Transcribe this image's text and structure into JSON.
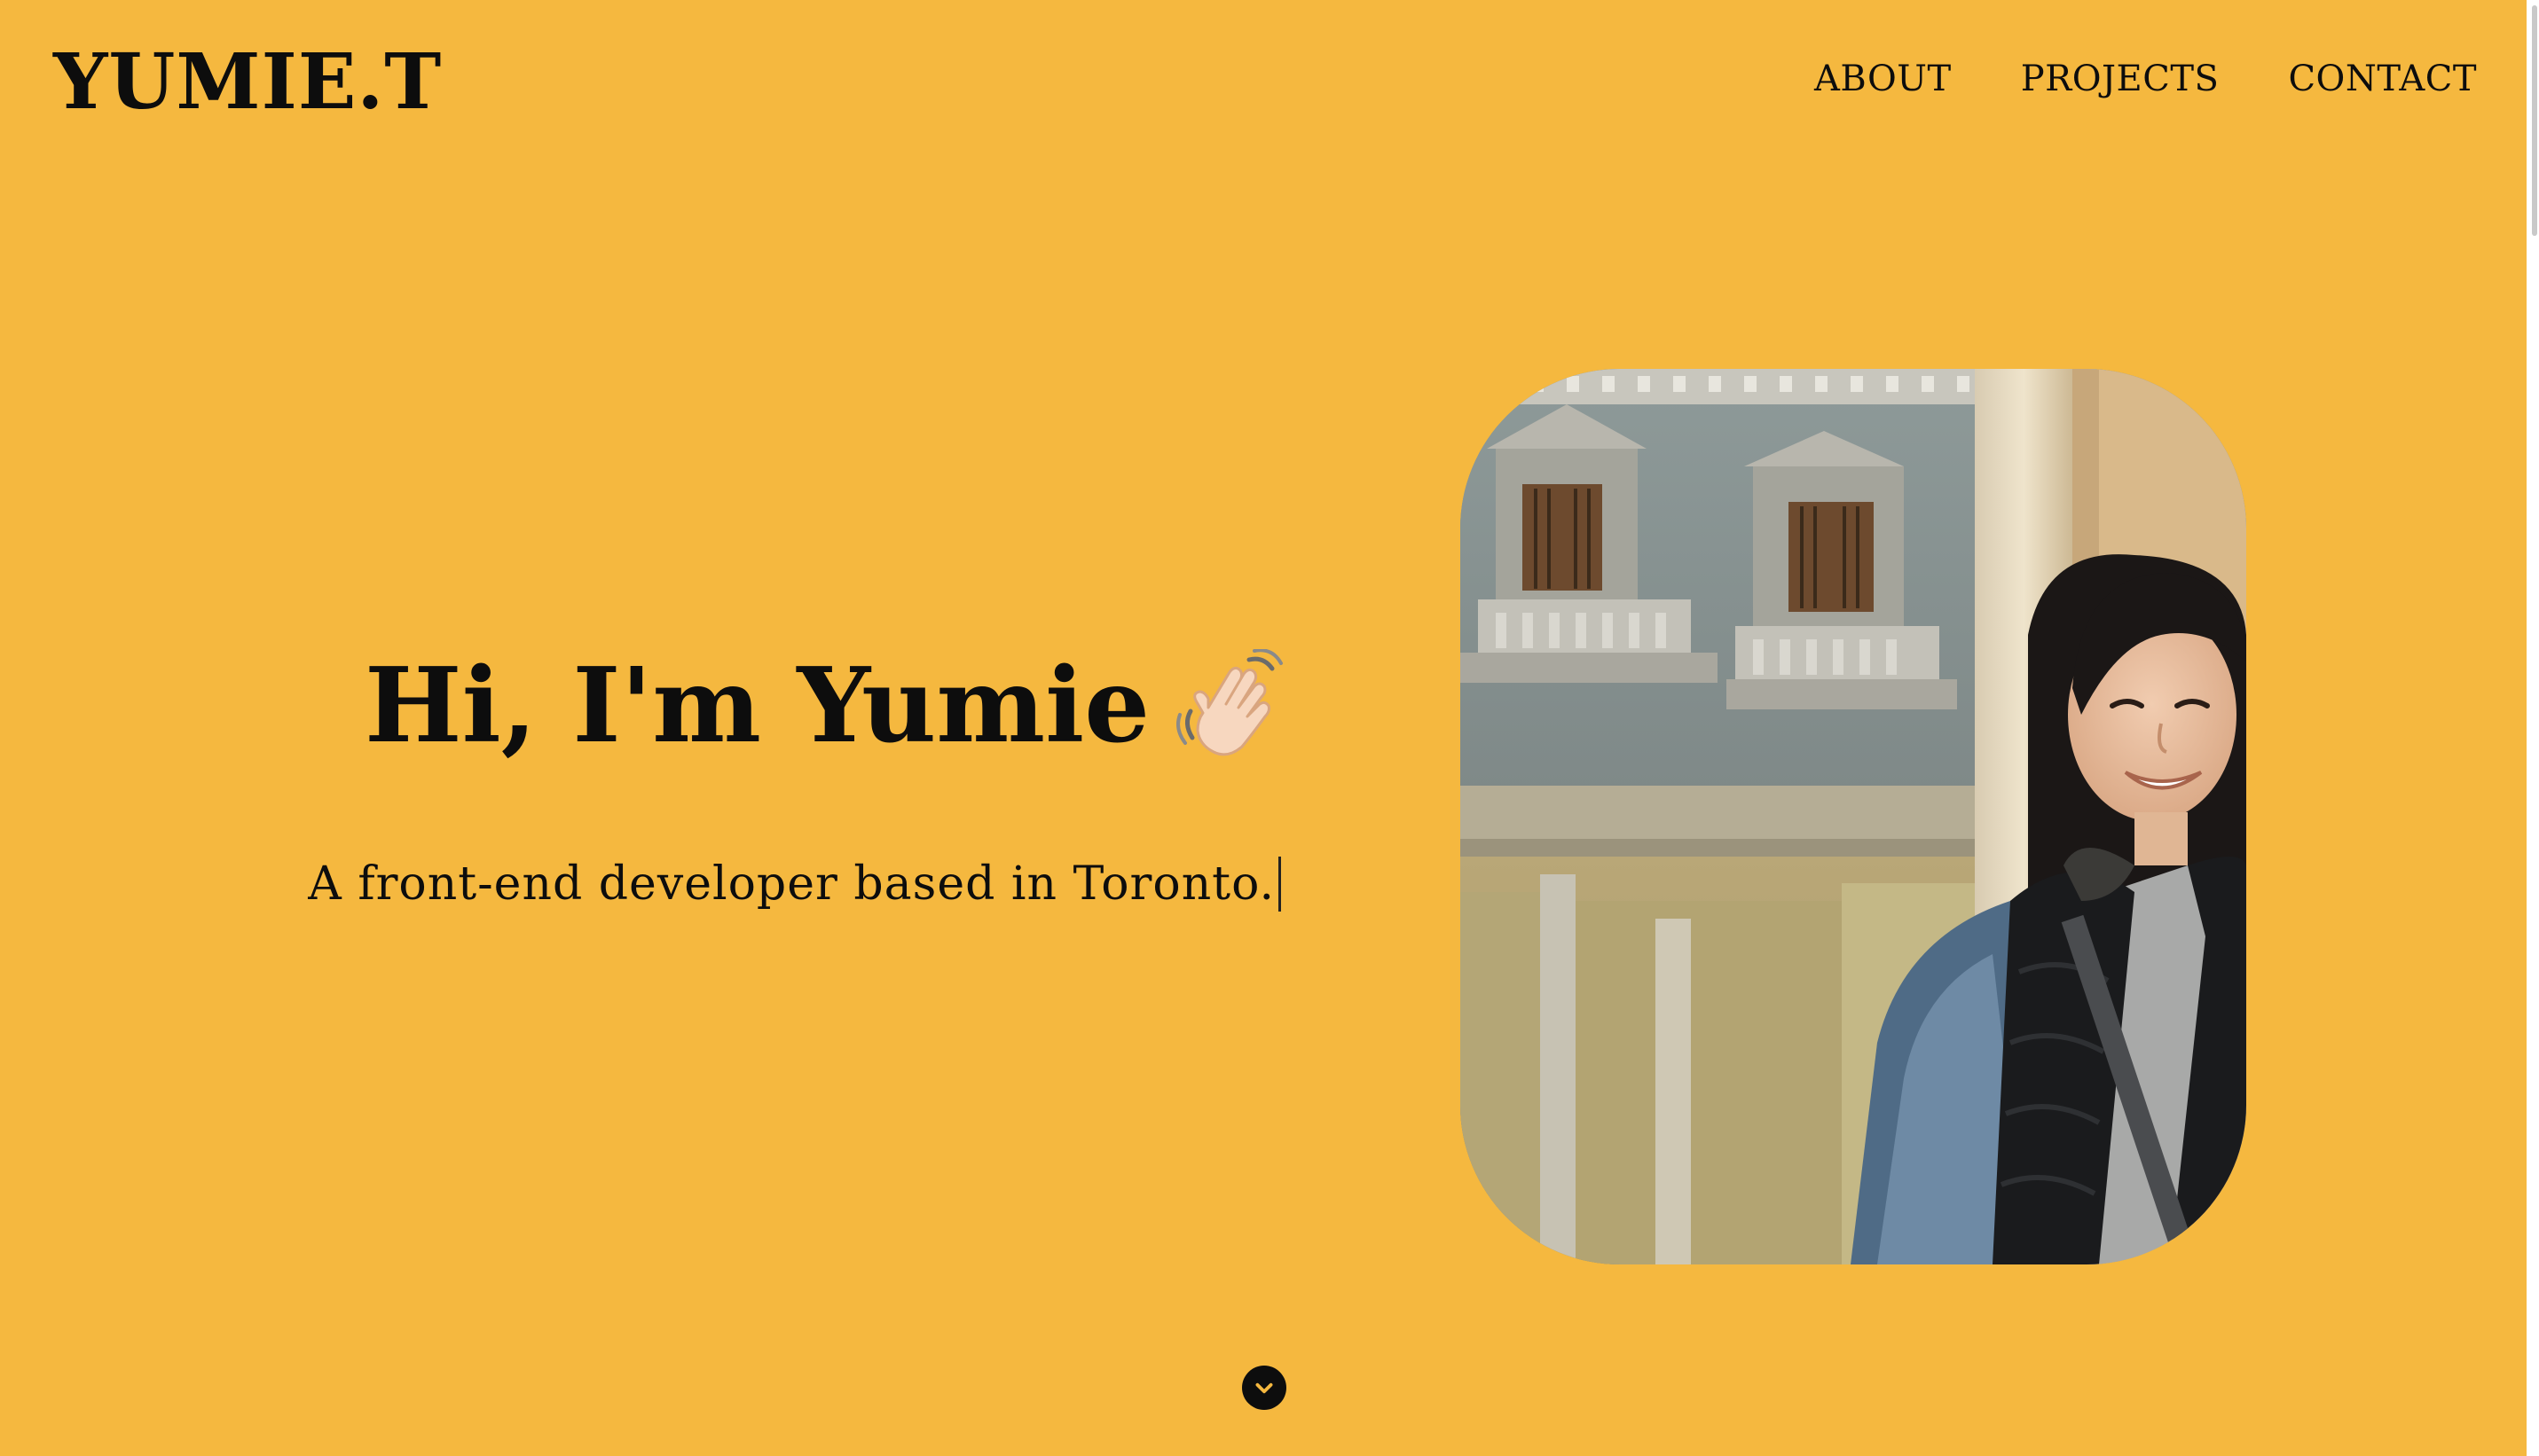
{
  "header": {
    "logo": "YUMIE.T",
    "nav": [
      "ABOUT",
      "PROJECTS",
      "CONTACT"
    ]
  },
  "hero": {
    "title": "Hi, I'm Yumie",
    "title_icon": "waving-hand-icon",
    "subtitle": "A front-end developer based in Toronto."
  },
  "photo": {
    "description_icon": "profile-photo"
  },
  "scroll": {
    "icon": "chevron-down-icon"
  },
  "colors": {
    "background": "#F5B83F",
    "text": "#0d0d0d"
  }
}
